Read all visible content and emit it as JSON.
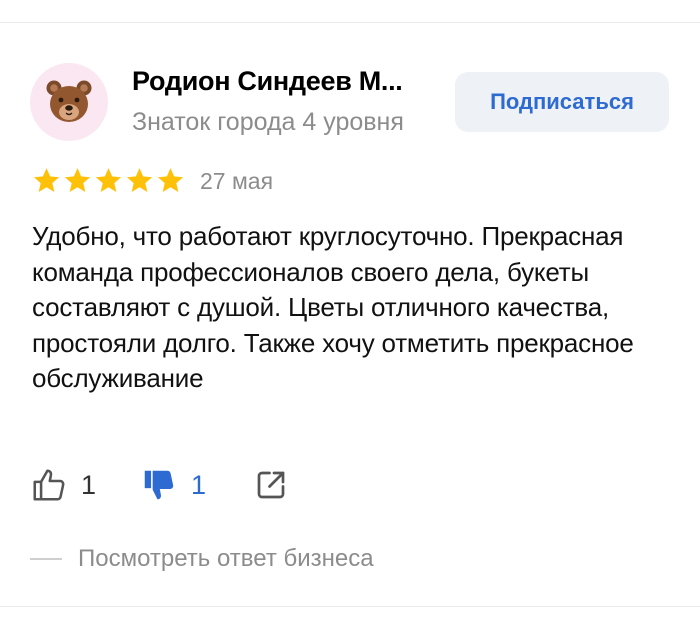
{
  "author": {
    "name": "Родион Синдеев М...",
    "level": "Знаток города 4 уровня",
    "avatar_icon": "bear-face-icon",
    "avatar_bg": "#fbe7f1"
  },
  "subscribe": {
    "label": "Подписаться"
  },
  "review": {
    "rating": 5,
    "rating_max": 5,
    "date": "27 мая",
    "text": "Удобно, что работают круглосуточно. Прекрасная команда профессионалов своего дела, букеты составляют с душой. Цветы отличного качества, простояли долго. Также хочу отметить прекрасное обслуживание"
  },
  "actions": {
    "likes": "1",
    "dislikes": "1",
    "like_icon": "thumbs-up-icon",
    "dislike_icon": "thumbs-down-icon",
    "share_icon": "share-icon"
  },
  "business_reply": {
    "label": "Посмотреть ответ бизнеса"
  },
  "colors": {
    "accent": "#2d6ad1",
    "star": "#ffc107",
    "muted_text": "#8c8c8c",
    "button_bg": "#eef2f7"
  }
}
